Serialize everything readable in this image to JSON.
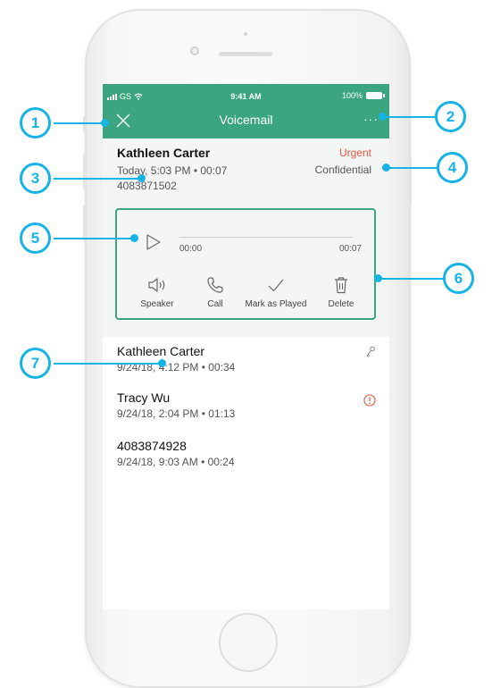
{
  "status_bar": {
    "carrier": "GS",
    "time": "9:41 AM",
    "battery": "100%"
  },
  "header": {
    "title": "Voicemail",
    "close_icon": "close-icon",
    "more_label": "···"
  },
  "voicemail": {
    "caller_name": "Kathleen Carter",
    "meta": "Today, 5:03 PM • 00:07",
    "number": "4083871502",
    "urgent_label": "Urgent",
    "confidential_label": "Confidential"
  },
  "player": {
    "time_start": "00:00",
    "time_end": "00:07",
    "progress": 0,
    "actions": [
      {
        "label": "Speaker",
        "icon": "speaker-icon"
      },
      {
        "label": "Call",
        "icon": "phone-icon"
      },
      {
        "label": "Mark as Played",
        "icon": "checkmark-icon"
      },
      {
        "label": "Delete",
        "icon": "trash-icon"
      }
    ]
  },
  "list": [
    {
      "name": "Kathleen Carter",
      "meta": "9/24/18, 4:12 PM • 00:34",
      "icon": "key-icon"
    },
    {
      "name": "Tracy Wu",
      "meta": "9/24/18, 2:04 PM • 01:13",
      "icon": "urgent-alert-icon"
    },
    {
      "name": "4083874928",
      "meta": "9/24/18, 9:03 AM • 00:24",
      "icon": ""
    }
  ],
  "callouts": [
    "1",
    "2",
    "3",
    "4",
    "5",
    "6",
    "7"
  ],
  "colors": {
    "accent": "#3aa57f",
    "urgent": "#e5533d",
    "callout": "#16b3e6"
  }
}
